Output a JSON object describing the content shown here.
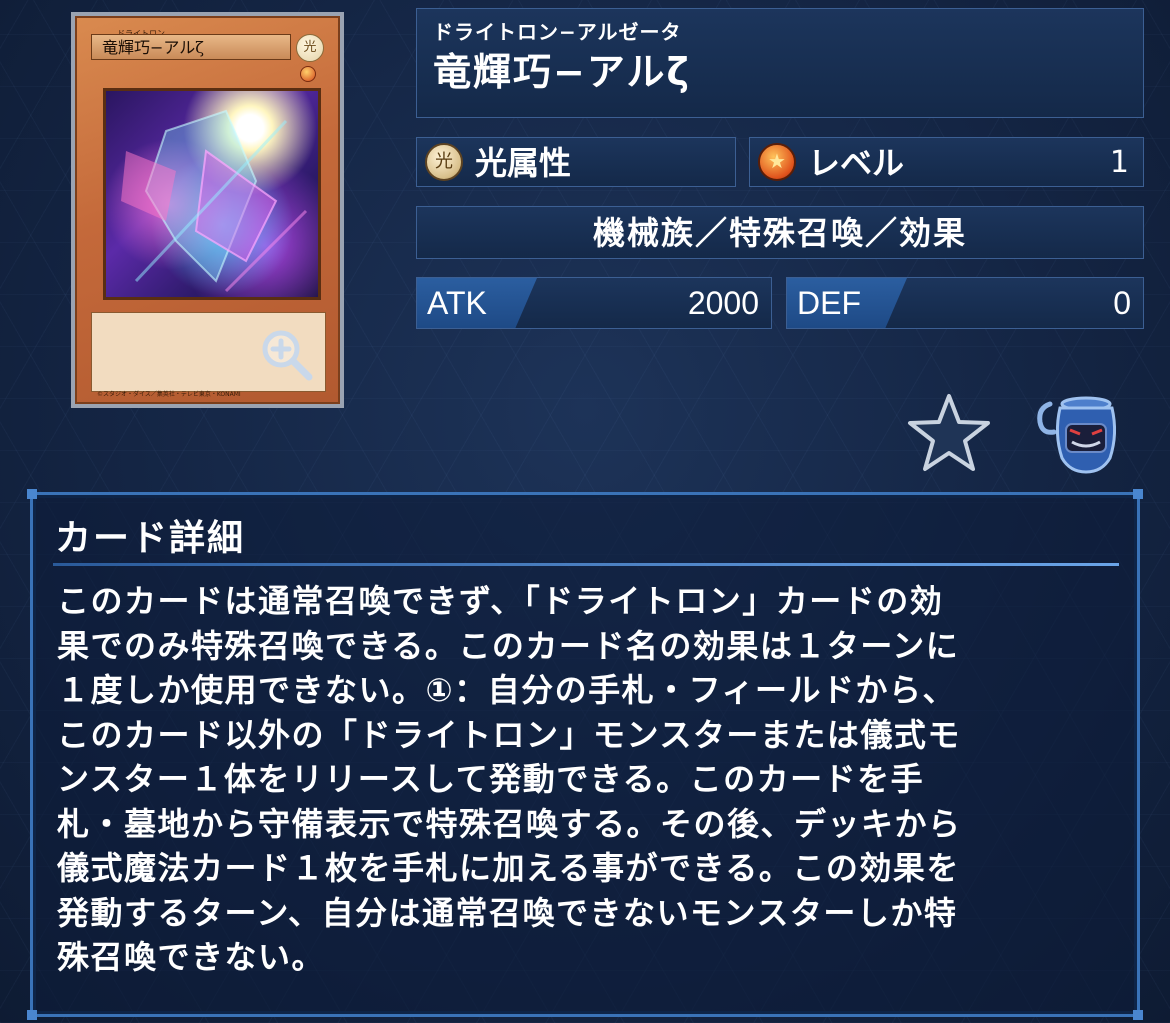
{
  "card": {
    "ruby": "ドライトロン−アルゼータ",
    "name": "竜輝巧−アルζ",
    "image_name_text": "竜輝巧−アルζ",
    "image_ruby_text": "ドライトロン",
    "image_attribute_glyph": "光",
    "image_copyright": "©スタジオ・ダイス／集英社・テレビ東京・KONAMI"
  },
  "attribute": {
    "icon": "light-attribute-icon",
    "glyph": "光",
    "label": "光属性"
  },
  "level": {
    "icon": "level-star-icon",
    "glyph": "★",
    "label": "レベル",
    "value": "1"
  },
  "type_line": "機械族／特殊召喚／効果",
  "stats": {
    "atk_label": "ATK",
    "atk_value": "2000",
    "def_label": "DEF",
    "def_value": "0"
  },
  "actions": {
    "favorite_icon": "star-icon",
    "pot_icon": "pot-of-greed-icon"
  },
  "details": {
    "title": "カード詳細",
    "text": "このカードは通常召喚できず、「ドライトロン」カードの効\n果でのみ特殊召喚できる。このカード名の効果は１ターンに\n１度しか使用できない。①：自分の手札・フィールドから、\nこのカード以外の「ドライトロン」モンスターまたは儀式モ\nンスター１体をリリースして発動できる。このカードを手\n札・墓地から守備表示で特殊召喚する。その後、デッキから\n儀式魔法カード１枚を手札に加える事ができる。この効果を\n発動するターン、自分は通常召喚できないモンスターしか特\n殊召喚できない。"
  },
  "colors": {
    "background": "#142544",
    "panel": "#1c355c",
    "panel_border": "#3c5f93",
    "stat_tab": "#2b5ea0",
    "detail_border": "#3a73b8",
    "card_frame": "#c4693a"
  }
}
